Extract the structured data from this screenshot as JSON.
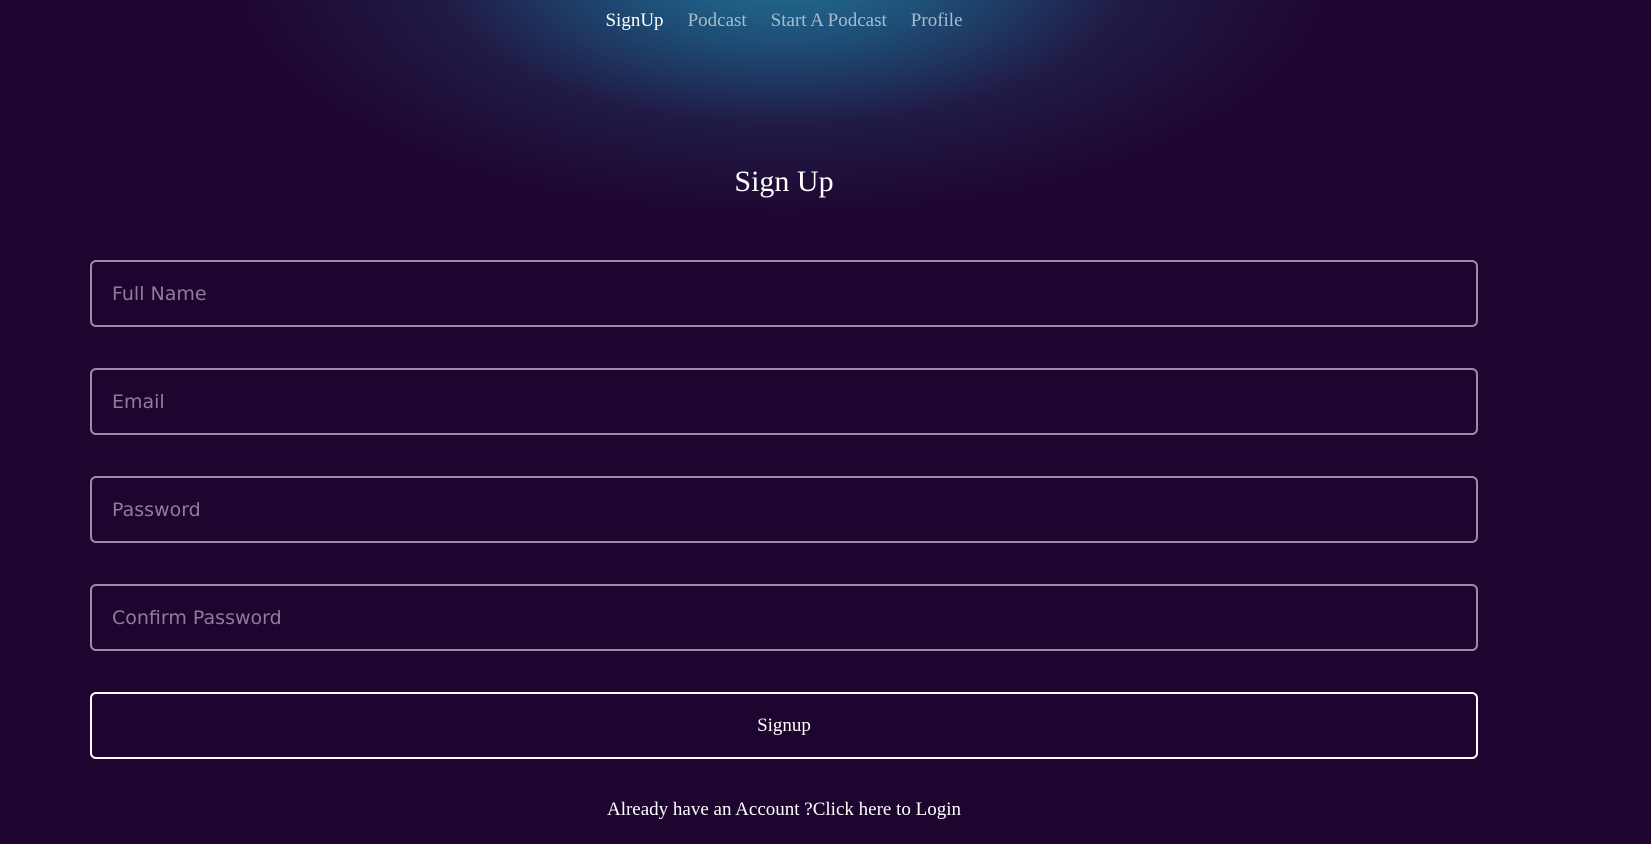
{
  "nav": {
    "items": [
      {
        "label": "SignUp",
        "active": true
      },
      {
        "label": "Podcast",
        "active": false
      },
      {
        "label": "Start A Podcast",
        "active": false
      },
      {
        "label": "Profile",
        "active": false
      }
    ]
  },
  "form": {
    "title": "Sign Up",
    "fields": {
      "full_name": {
        "placeholder": "Full Name",
        "value": ""
      },
      "email": {
        "placeholder": "Email",
        "value": ""
      },
      "password": {
        "placeholder": "Password",
        "value": ""
      },
      "confirm_password": {
        "placeholder": "Confirm Password",
        "value": ""
      }
    },
    "submit_label": "Signup",
    "login_prompt": "Already have an Account ?Click here to Login"
  },
  "colors": {
    "background": "#1e0530",
    "glow": "#22789e",
    "field_border": "#9d8aa6",
    "active_nav": "#ffffff",
    "inactive_nav": "#a9bccd"
  }
}
